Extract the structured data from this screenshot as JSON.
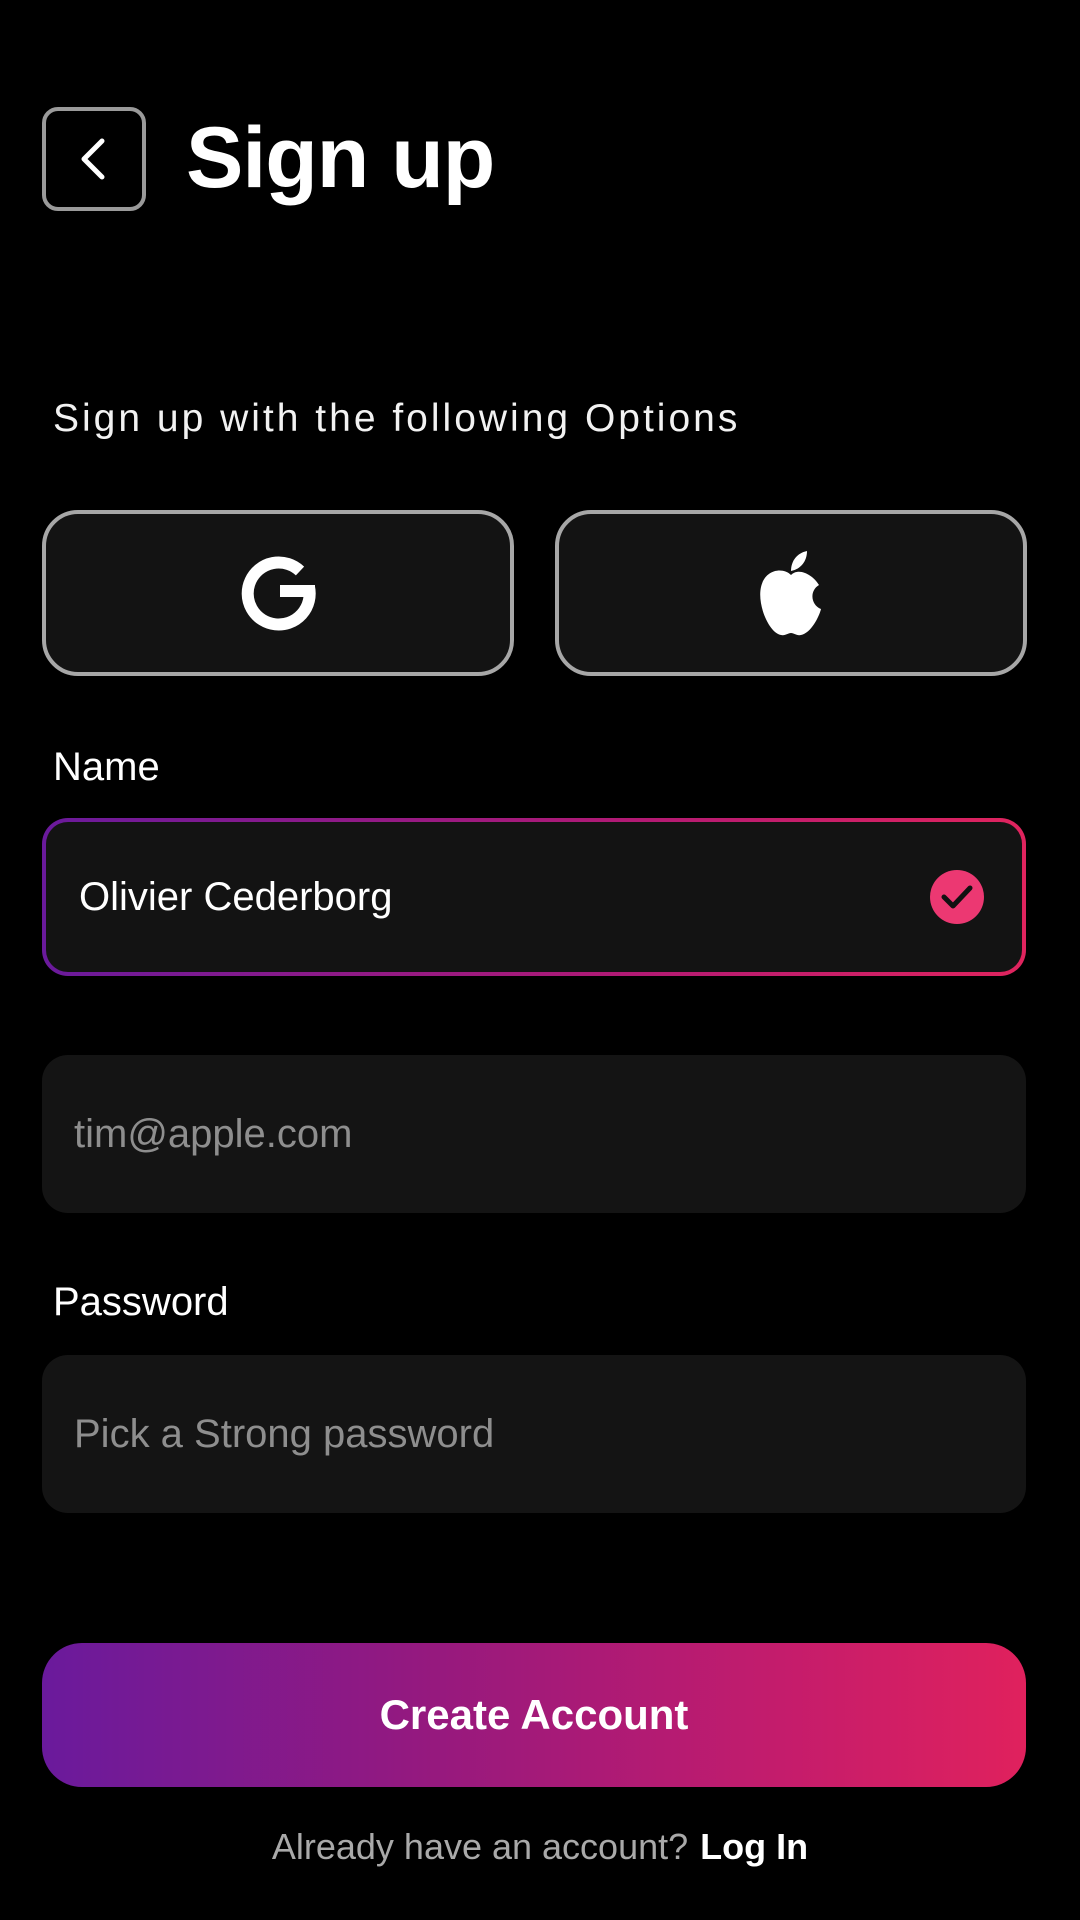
{
  "header": {
    "title": "Sign up",
    "back_icon": "chevron-left-icon"
  },
  "options": {
    "label": "Sign up with the following Options",
    "google_icon": "google-icon",
    "apple_icon": "apple-icon"
  },
  "name_field": {
    "label": "Name",
    "value": "Olivier Cederborg",
    "status_icon": "check-circle-icon"
  },
  "email_field": {
    "placeholder": "tim@apple.com"
  },
  "password_field": {
    "label": "Password",
    "placeholder": "Pick a Strong password"
  },
  "create_account": {
    "label": "Create Account"
  },
  "footer": {
    "prompt": "Already have an account?",
    "login_label": "Log In"
  },
  "colors": {
    "background": "#000000",
    "field_background": "#131313",
    "gradient_start": "#6a1a9c",
    "gradient_end": "#e0215d",
    "check_color": "#ec3872"
  }
}
